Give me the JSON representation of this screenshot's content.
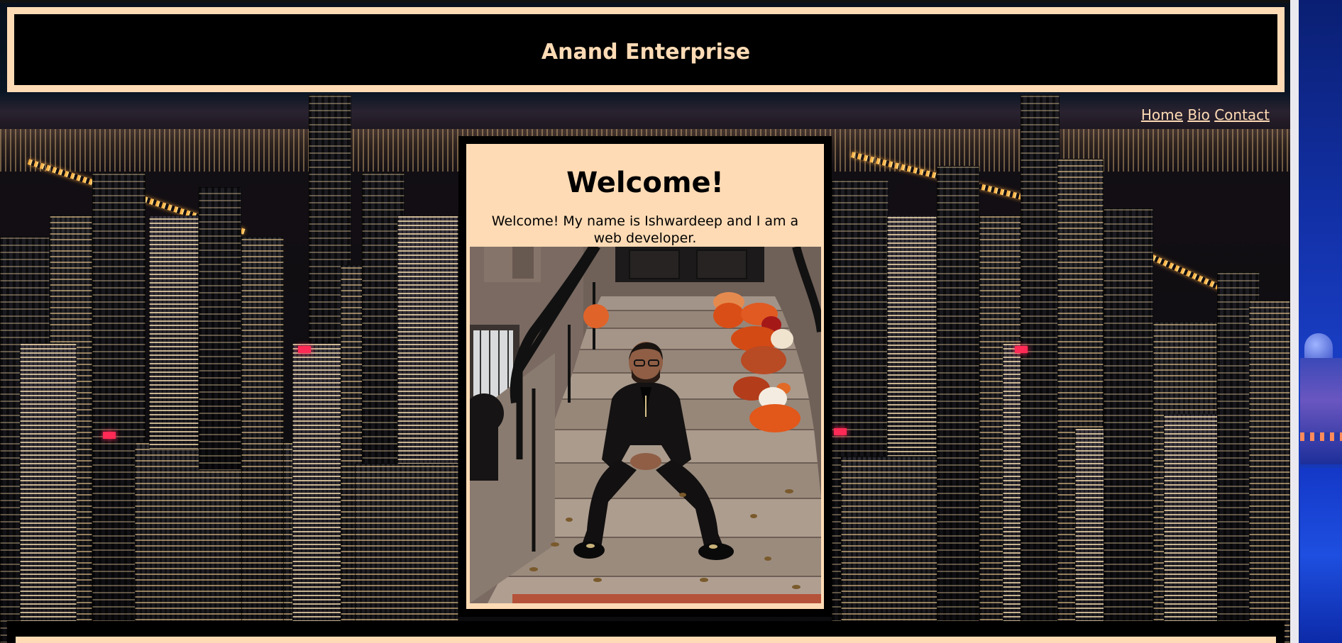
{
  "header": {
    "title": "Anand Enterprise"
  },
  "nav": {
    "items": [
      {
        "label": "Home"
      },
      {
        "label": "Bio"
      },
      {
        "label": "Contact"
      }
    ]
  },
  "welcome": {
    "heading": "Welcome!",
    "text": "Welcome! My name is Ishwardeep and I am a web developer."
  },
  "colors": {
    "accent": "#ffdbb5",
    "frame": "#000000",
    "desktop": "#1434b0"
  }
}
